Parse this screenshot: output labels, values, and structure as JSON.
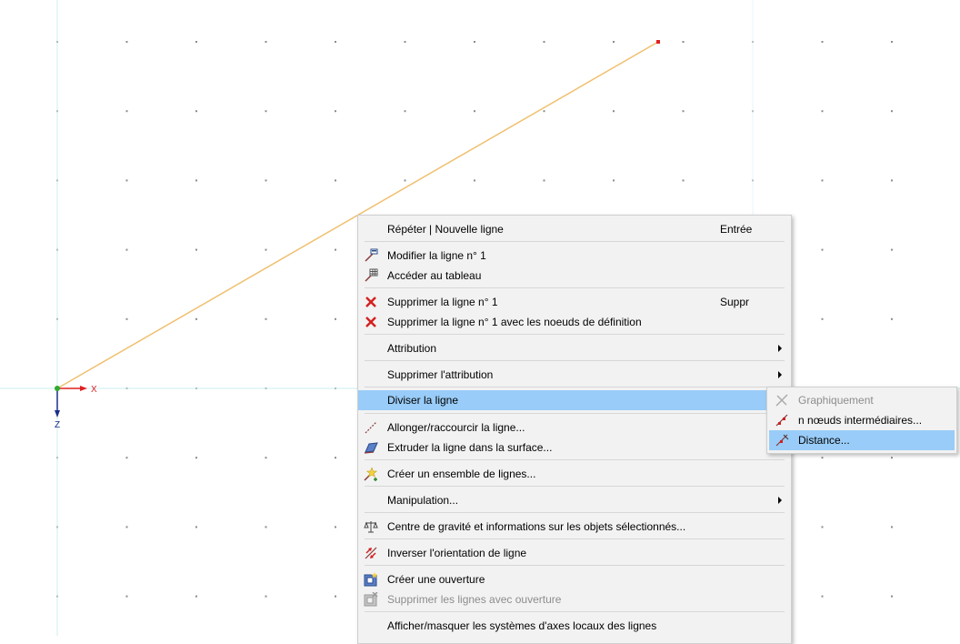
{
  "viewport": {
    "axis_x_label": "X",
    "axis_z_label": "Z"
  },
  "context_menu": {
    "items": [
      {
        "label": "Répéter | Nouvelle ligne",
        "shortcut": "Entrée"
      },
      {
        "label": "Modifier la ligne n° 1"
      },
      {
        "label": "Accéder au tableau"
      },
      {
        "label": "Supprimer la ligne n° 1",
        "shortcut": "Suppr"
      },
      {
        "label": "Supprimer la ligne n° 1 avec les noeuds de définition"
      },
      {
        "label": "Attribution"
      },
      {
        "label": "Supprimer l'attribution"
      },
      {
        "label": "Diviser la ligne"
      },
      {
        "label": "Allonger/raccourcir la ligne..."
      },
      {
        "label": "Extruder la ligne dans la surface..."
      },
      {
        "label": "Créer un ensemble de lignes..."
      },
      {
        "label": "Manipulation..."
      },
      {
        "label": "Centre de gravité et informations sur les objets sélectionnés..."
      },
      {
        "label": "Inverser l'orientation de ligne"
      },
      {
        "label": "Créer une ouverture"
      },
      {
        "label": "Supprimer les lignes avec ouverture"
      },
      {
        "label": "Afficher/masquer les systèmes d'axes locaux des lignes"
      }
    ]
  },
  "submenu": {
    "items": [
      {
        "label": "Graphiquement"
      },
      {
        "label": "n nœuds intermédiaires..."
      },
      {
        "label": "Distance..."
      }
    ]
  },
  "colors": {
    "line": "#f0c070",
    "highlight": "#99ccf8",
    "axis_x": "#e02020",
    "axis_z": "#1a2f8a",
    "node": "#e02020"
  }
}
